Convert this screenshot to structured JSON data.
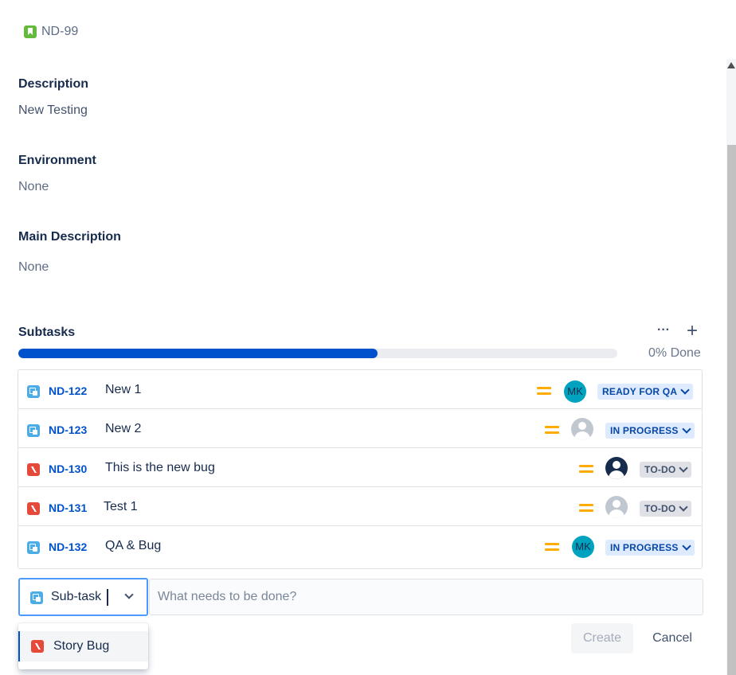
{
  "issue": {
    "key": "ND-99",
    "type_icon": "story-icon"
  },
  "fields": {
    "description": {
      "label": "Description",
      "value": "New Testing"
    },
    "environment": {
      "label": "Environment",
      "value": "None"
    },
    "main_description": {
      "label": "Main Description",
      "value": "None"
    }
  },
  "subtasks": {
    "title": "Subtasks",
    "more_label": "···",
    "add_label": "+",
    "progress": {
      "fill_fraction": 0.6,
      "text": "0% Done",
      "color": "#0052cc"
    },
    "rows": [
      {
        "key": "ND-122",
        "summary": "New 1",
        "type_icon": "subtask-icon",
        "priority": "medium",
        "assignee": "MK",
        "status": "READY FOR QA"
      },
      {
        "key": "ND-123",
        "summary": "New 2",
        "type_icon": "subtask-icon",
        "priority": "medium",
        "assignee": "",
        "status": "IN PROGRESS"
      },
      {
        "key": "ND-130",
        "summary": "This is the new bug",
        "type_icon": "bug-icon",
        "priority": "medium",
        "assignee": "",
        "status": "TO-DO"
      },
      {
        "key": "ND-131",
        "summary": "Test 1",
        "type_icon": "bug-icon",
        "priority": "medium",
        "assignee": "",
        "status": "TO-DO"
      },
      {
        "key": "ND-132",
        "summary": "QA & Bug",
        "type_icon": "subtask-icon",
        "priority": "medium",
        "assignee": "MK",
        "status": "IN PROGRESS"
      }
    ]
  },
  "create_form": {
    "type_selected": "Sub-task",
    "summary_placeholder": "What needs to be done?",
    "dropdown_options": [
      "Story Bug"
    ],
    "create_label": "Create",
    "cancel_label": "Cancel"
  }
}
